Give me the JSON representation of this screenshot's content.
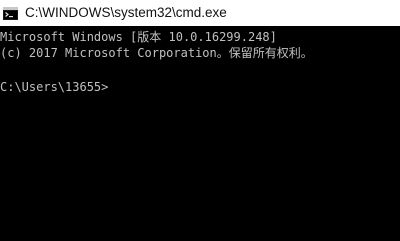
{
  "window": {
    "title": "C:\\WINDOWS\\system32\\cmd.exe",
    "icon": "console-app-icon"
  },
  "console": {
    "lines": [
      "Microsoft Windows [版本 10.0.16299.248]",
      "(c) 2017 Microsoft Corporation。保留所有权利。"
    ],
    "prompt": "C:\\Users\\13655>",
    "colors": {
      "background": "#000000",
      "text": "#c0c0c0"
    }
  }
}
